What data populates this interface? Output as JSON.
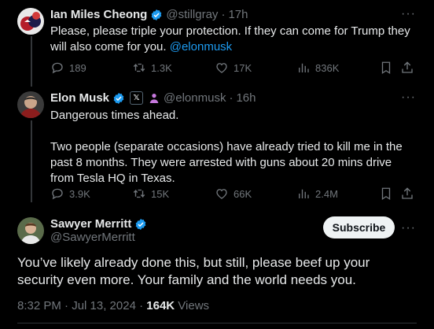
{
  "tweets": [
    {
      "name": "Ian Miles Cheong",
      "handle": "@stillgray",
      "time": "17h",
      "text": "Please, please triple your protection. If they can come for Trump they will also come for you.",
      "mention": "@elonmusk",
      "replies": "189",
      "reposts": "1.3K",
      "likes": "17K",
      "views": "836K"
    },
    {
      "name": "Elon Musk",
      "handle": "@elonmusk",
      "time": "16h",
      "line1": "Dangerous times ahead.",
      "para2": "Two people (separate occasions) have already tried to kill me in the past 8 months. They were arrested with guns about 20 mins drive from Tesla HQ in Texas.",
      "replies": "3.9K",
      "reposts": "15K",
      "likes": "66K",
      "views": "2.4M"
    }
  ],
  "main": {
    "name": "Sawyer Merritt",
    "handle": "@SawyerMerritt",
    "subscribe_label": "Subscribe",
    "text": "You’ve likely already done this, but still, please beef up your security even more. Your family and the world needs you.",
    "time": "8:32 PM · Jul 13, 2024 ·",
    "views_count": "164K",
    "views_label": "Views"
  },
  "more_label": "···",
  "separator": "·",
  "colors": {
    "accent": "#1d9bf0",
    "verified": "#1d9bf0",
    "muted": "#71767b",
    "text": "#e7e9ea"
  },
  "icons": [
    "reply-icon",
    "repost-icon",
    "like-icon",
    "views-icon",
    "bookmark-icon",
    "share-icon",
    "verified-icon",
    "x-badge-icon",
    "affiliate-icon",
    "more-icon"
  ]
}
